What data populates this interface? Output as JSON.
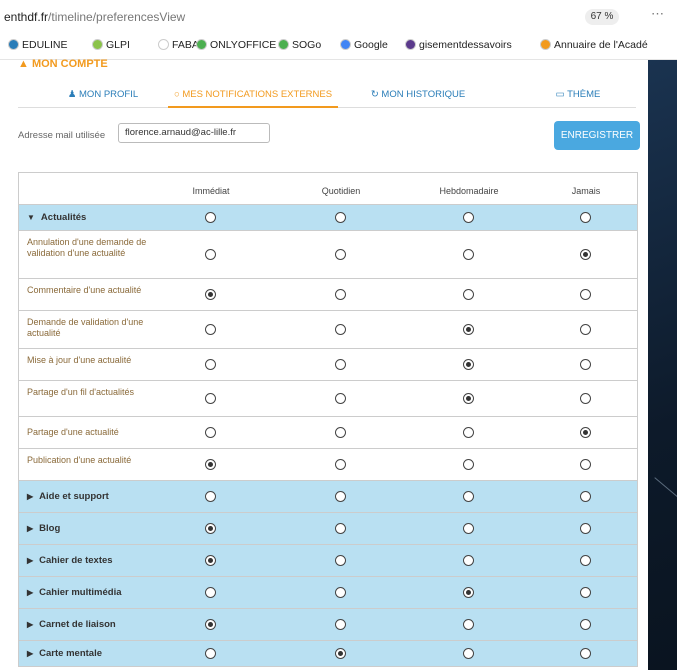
{
  "browser": {
    "url_host": "enthdf.fr",
    "url_path": "/timeline/preferencesView",
    "zoom": "67 %",
    "more": "⋯"
  },
  "bookmarks": [
    {
      "label": "EDULINE",
      "color": "#2a7db8"
    },
    {
      "label": "GLPI",
      "color": "#8bc34a"
    },
    {
      "label": "FABA",
      "color": "#ffffff"
    },
    {
      "label": "ONLYOFFICE",
      "color": "#4caf50"
    },
    {
      "label": "SOGo",
      "color": "#4caf50"
    },
    {
      "label": "Google",
      "color": "#4285f4"
    },
    {
      "label": "gisementdessavoirs",
      "color": "#5b3a8c"
    },
    {
      "label": "Annuaire de l'Acadé",
      "color": "#f29a1e"
    }
  ],
  "page": {
    "account_title": "MON COMPTE",
    "tabs": [
      "MON PROFIL",
      "MES NOTIFICATIONS EXTERNES",
      "MON HISTORIQUE",
      "THÈME"
    ],
    "mail_label": "Adresse mail utilisée",
    "mail_value": "florence.arnaud@ac-lille.fr",
    "save_label": "ENREGISTRER"
  },
  "table": {
    "columns": [
      "Immédiat",
      "Quotidien",
      "Hebdomadaire",
      "Jamais"
    ],
    "rows": [
      {
        "label": "Actualités",
        "category": true,
        "expanded": true,
        "selected": -1
      },
      {
        "label": "Annulation d'une demande de validation d'une actualité",
        "category": false,
        "selected": 3
      },
      {
        "label": "Commentaire d'une actualité",
        "category": false,
        "selected": 0
      },
      {
        "label": "Demande de validation d'une actualité",
        "category": false,
        "selected": 2
      },
      {
        "label": "Mise à jour d'une actualité",
        "category": false,
        "selected": 2
      },
      {
        "label": "Partage d'un fil d'actualités",
        "category": false,
        "selected": 2
      },
      {
        "label": "Partage d'une actualité",
        "category": false,
        "selected": 3
      },
      {
        "label": "Publication d'une actualité",
        "category": false,
        "selected": 0
      },
      {
        "label": "Aide et support",
        "category": true,
        "expanded": false,
        "selected": -1
      },
      {
        "label": "Blog",
        "category": true,
        "expanded": false,
        "selected": 0
      },
      {
        "label": "Cahier de textes",
        "category": true,
        "expanded": false,
        "selected": 0
      },
      {
        "label": "Cahier multimédia",
        "category": true,
        "expanded": false,
        "selected": 2
      },
      {
        "label": "Carnet de liaison",
        "category": true,
        "expanded": false,
        "selected": 0
      },
      {
        "label": "Carte mentale",
        "category": true,
        "expanded": false,
        "selected": 1
      }
    ]
  }
}
